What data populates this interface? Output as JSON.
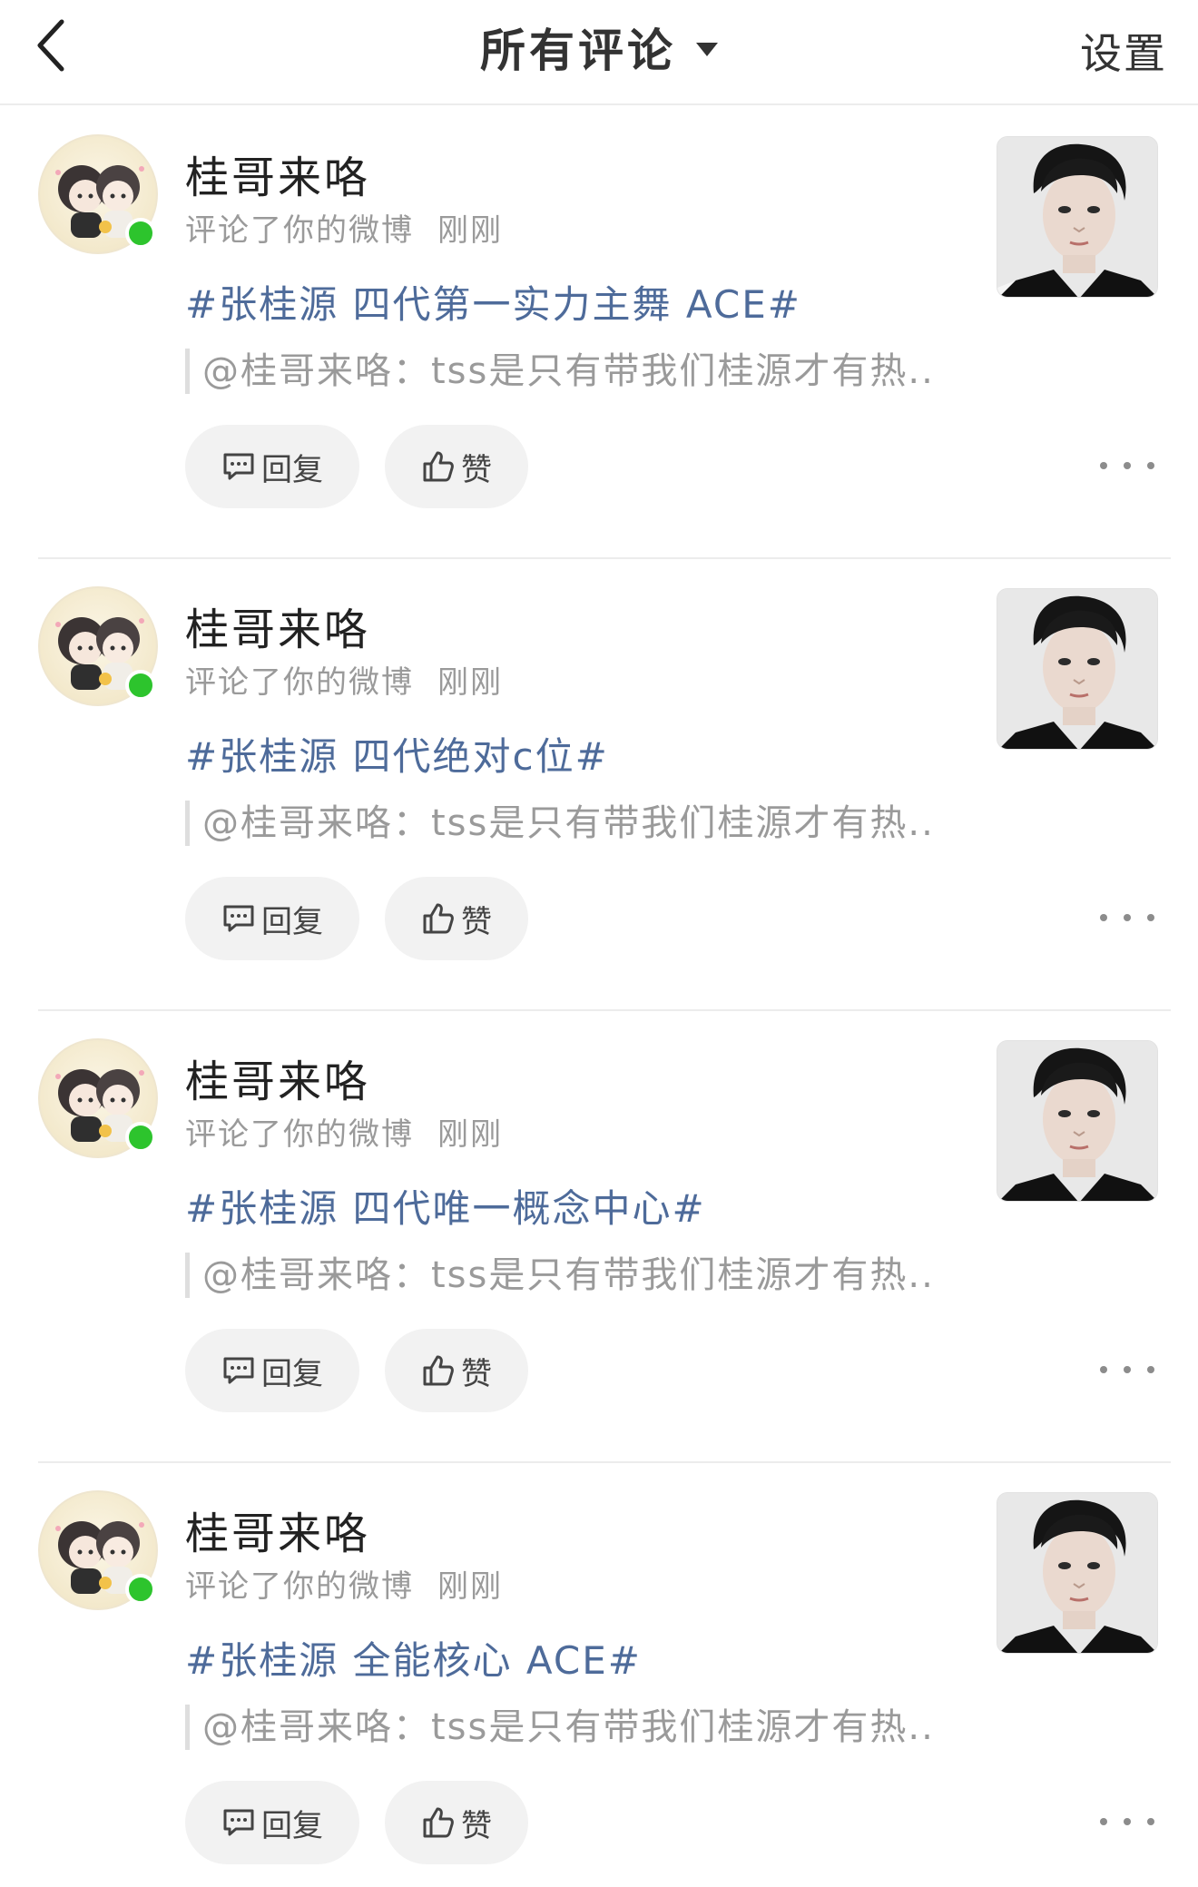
{
  "header": {
    "title": "所有评论",
    "settings_label": "设置"
  },
  "items": [
    {
      "user_name": "桂哥来咯",
      "action": "评论了你的微博",
      "time": "刚刚",
      "topic": "#张桂源 四代第一实力主舞 ACE#",
      "quote": "@桂哥来咯：tss是只有带我们桂源才有热...",
      "reply_label": "回复",
      "like_label": "赞"
    },
    {
      "user_name": "桂哥来咯",
      "action": "评论了你的微博",
      "time": "刚刚",
      "topic": "#张桂源 四代绝对c位#",
      "quote": "@桂哥来咯：tss是只有带我们桂源才有热...",
      "reply_label": "回复",
      "like_label": "赞"
    },
    {
      "user_name": "桂哥来咯",
      "action": "评论了你的微博",
      "time": "刚刚",
      "topic": "#张桂源 四代唯一概念中心#",
      "quote": "@桂哥来咯：tss是只有带我们桂源才有热...",
      "reply_label": "回复",
      "like_label": "赞"
    },
    {
      "user_name": "桂哥来咯",
      "action": "评论了你的微博",
      "time": "刚刚",
      "topic": "#张桂源 全能核心 ACE#",
      "quote": "@桂哥来咯：tss是只有带我们桂源才有热...",
      "reply_label": "回复",
      "like_label": "赞"
    }
  ],
  "colors": {
    "topic": "#4e6b9a",
    "online": "#2dc42d",
    "secondary_text": "#9a9a9a",
    "pill_bg": "#f2f2f2"
  },
  "icons": {
    "back": "chevron-left-icon",
    "dropdown": "caret-down-icon",
    "reply": "comment-icon",
    "like": "thumbs-up-icon",
    "more": "more-horizontal-icon"
  }
}
